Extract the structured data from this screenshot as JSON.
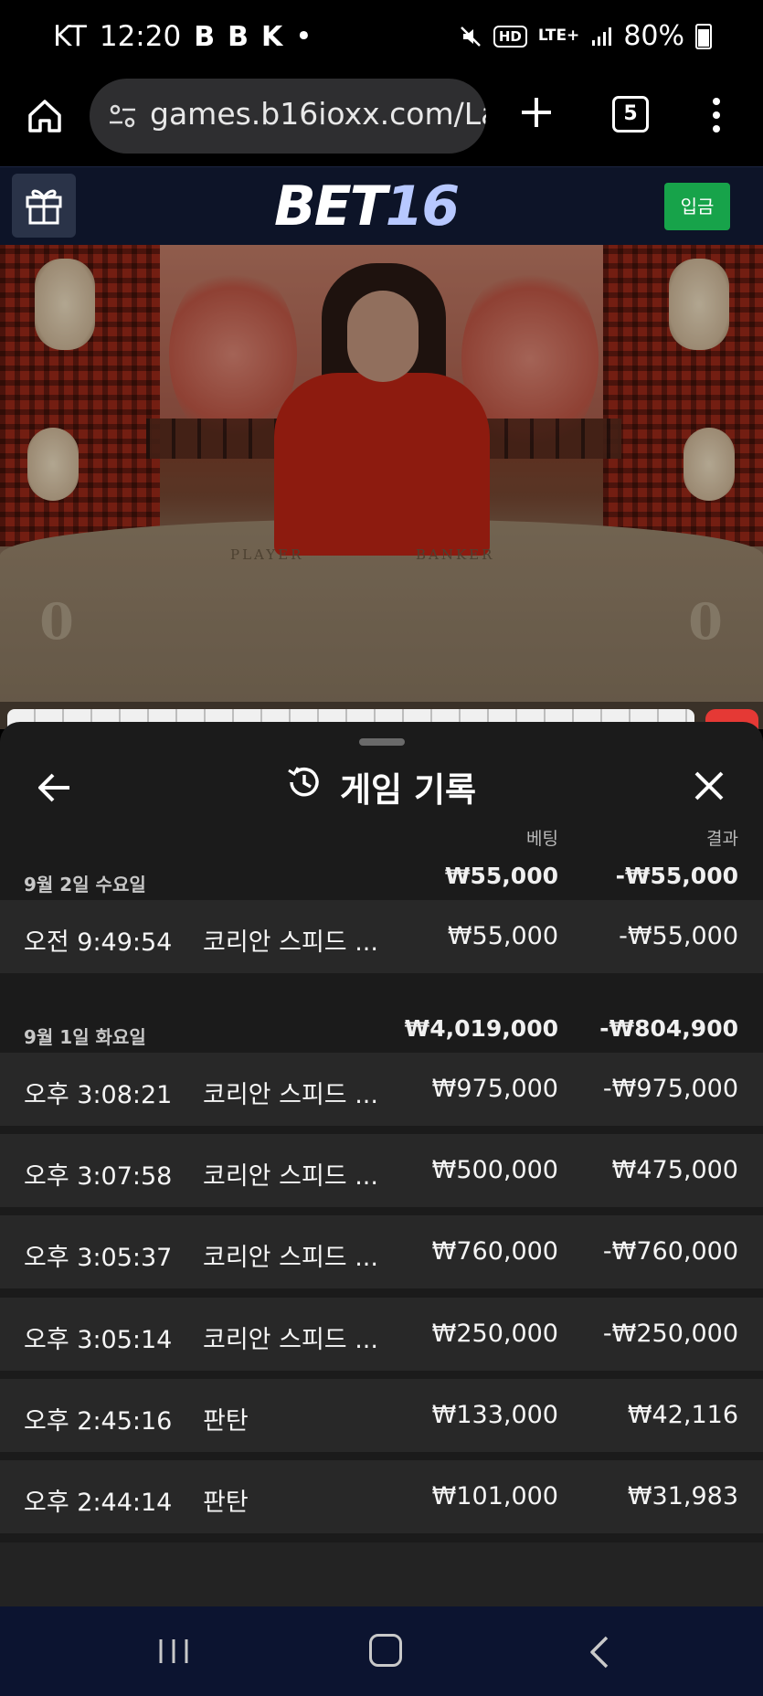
{
  "status_bar": {
    "carrier": "KT",
    "time": "12:20",
    "notif_icons": [
      "B",
      "B",
      "K"
    ],
    "dot": "•",
    "hd": "HD",
    "network": "LTE+",
    "battery": "80%"
  },
  "browser": {
    "url": "games.b16ioxx.com/La",
    "tab_count": "5"
  },
  "site": {
    "logo_part1": "BET",
    "logo_part2": "16",
    "deposit_label": "입금"
  },
  "video": {
    "player_label": "PLAYER",
    "banker_label": "BANKER",
    "player_score": "0",
    "banker_score": "0"
  },
  "sheet": {
    "title": "게임 기록",
    "col_bet": "베팅",
    "col_result": "결과",
    "groups": [
      {
        "date": "9월 2일 수요일",
        "total_bet": "₩55,000",
        "total_result": "-₩55,000",
        "rows": [
          {
            "time": "오전 9:49:54",
            "game": "코리안 스피드 ...",
            "bet": "₩55,000",
            "result": "-₩55,000"
          }
        ]
      },
      {
        "date": "9월 1일 화요일",
        "total_bet": "₩4,019,000",
        "total_result": "-₩804,900",
        "rows": [
          {
            "time": "오후 3:08:21",
            "game": "코리안 스피드 ...",
            "bet": "₩975,000",
            "result": "-₩975,000"
          },
          {
            "time": "오후 3:07:58",
            "game": "코리안 스피드 ...",
            "bet": "₩500,000",
            "result": "₩475,000"
          },
          {
            "time": "오후 3:05:37",
            "game": "코리안 스피드 ...",
            "bet": "₩760,000",
            "result": "-₩760,000"
          },
          {
            "time": "오후 3:05:14",
            "game": "코리안 스피드 ...",
            "bet": "₩250,000",
            "result": "-₩250,000"
          },
          {
            "time": "오후 2:45:16",
            "game": "판탄",
            "bet": "₩133,000",
            "result": "₩42,116"
          },
          {
            "time": "오후 2:44:14",
            "game": "판탄",
            "bet": "₩101,000",
            "result": "₩31,983"
          }
        ]
      }
    ]
  },
  "colors": {
    "header_bg": "#0d1428",
    "deposit_green": "#17a34a",
    "sheet_bg": "#1b1b1b",
    "row_bg": "#282828"
  }
}
